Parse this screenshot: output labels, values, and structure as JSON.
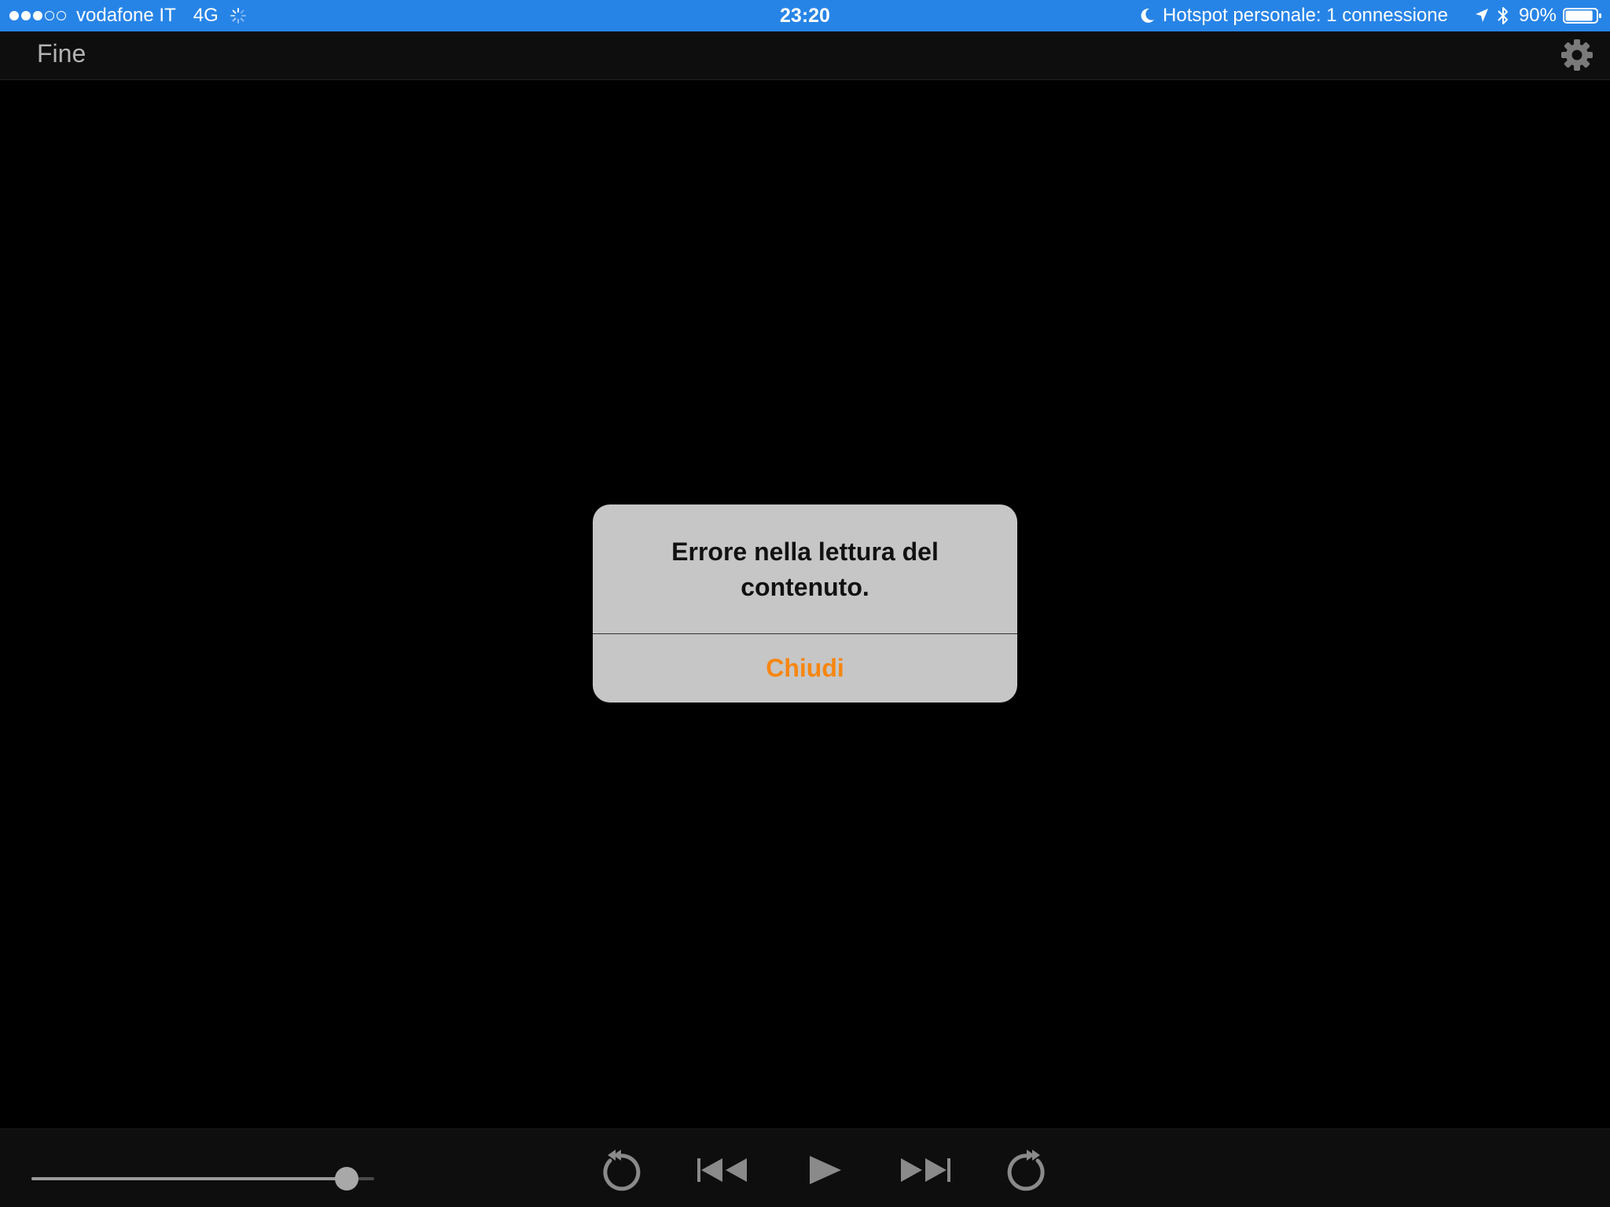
{
  "status_bar": {
    "signal_filled": 3,
    "signal_empty": 2,
    "carrier": "vodafone IT",
    "network": "4G",
    "time": "23:20",
    "hotspot": "Hotspot personale: 1 connessione",
    "battery_percent": "90%",
    "battery_level": 0.9,
    "icons": [
      "activity-icon",
      "moon-icon",
      "location-icon",
      "bluetooth-icon",
      "battery-icon"
    ]
  },
  "nav_bar": {
    "done_label": "Fine",
    "settings_icon": "gear-icon"
  },
  "alert": {
    "message": "Errore nella lettura del contenuto.",
    "close_label": "Chiudi",
    "close_color": "#f7860f"
  },
  "toolbar": {
    "volume_level": 0.92,
    "controls": [
      "rewind-icon",
      "skip-back-icon",
      "play-icon",
      "skip-forward-icon",
      "fast-forward-icon"
    ]
  },
  "colors": {
    "status_bar": "#2784e7",
    "background": "#000000",
    "alert_background": "#c6c6c6",
    "control_gray": "#8a8a8a"
  }
}
